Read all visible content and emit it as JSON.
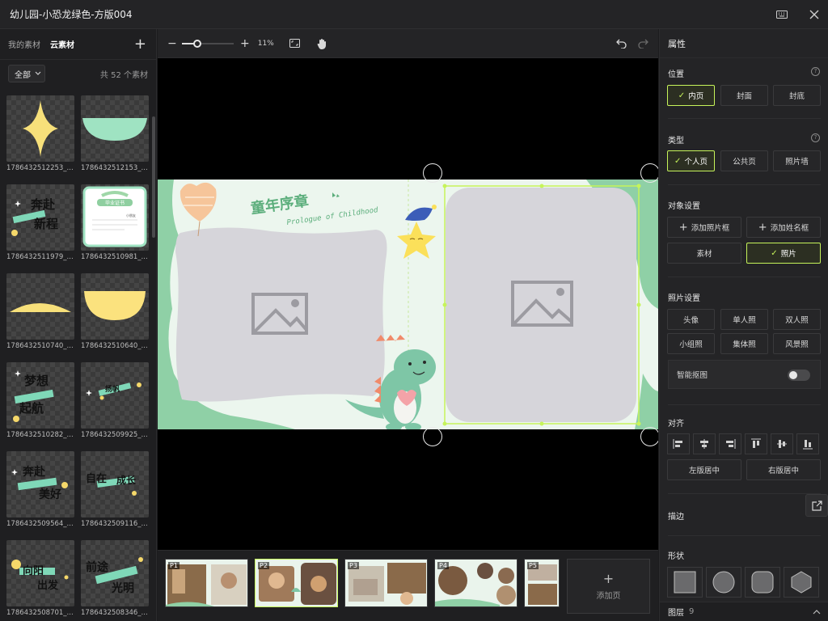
{
  "window": {
    "title": "幼儿园-小恐龙绿色-方版004"
  },
  "left_panel": {
    "tabs": [
      {
        "label": "我的素材",
        "active": false
      },
      {
        "label": "云素材",
        "active": true
      }
    ],
    "filter": {
      "selected": "全部",
      "count_text": "共 52 个素材"
    },
    "assets": [
      {
        "label": "1786432512253_...",
        "icon": "four-point-star"
      },
      {
        "label": "1786432512153_...",
        "icon": "green-half-circle"
      },
      {
        "label": "1786432511979_...",
        "icon": "calligraphy-title"
      },
      {
        "label": "1786432510981_...",
        "icon": "certificate-card"
      },
      {
        "label": "1786432510740_...",
        "icon": "yellow-wave"
      },
      {
        "label": "1786432510640_...",
        "icon": "yellow-half-circle"
      },
      {
        "label": "1786432510282_...",
        "icon": "calligraphy-title"
      },
      {
        "label": "1786432509925_...",
        "icon": "calligraphy-title"
      },
      {
        "label": "1786432509564_...",
        "icon": "calligraphy-title"
      },
      {
        "label": "1786432509116_...",
        "icon": "calligraphy-title"
      },
      {
        "label": "1786432508701_...",
        "icon": "calligraphy-title"
      },
      {
        "label": "1786432508346_...",
        "icon": "calligraphy-title"
      }
    ],
    "asset_texts": {
      "a3": [
        "奔赴",
        "新程"
      ],
      "a4_title": "毕业证书",
      "a4_name": "小朋友",
      "a7": [
        "梦想",
        "起航"
      ],
      "a8": "扬帆",
      "a9": [
        "奔赴",
        "美好"
      ],
      "a10": [
        "自在",
        "成长"
      ],
      "a11": [
        "向阳",
        "出发"
      ],
      "a12": [
        "前途",
        "光明"
      ]
    }
  },
  "toolbar": {
    "zoom": "11%",
    "zoom_level": 0.3
  },
  "canvas": {
    "spread_title": "童年序章",
    "spread_subtitle": "Prologue of Childhood"
  },
  "pages": [
    {
      "label": "P1",
      "active": false
    },
    {
      "label": "P2",
      "active": true
    },
    {
      "label": "P3",
      "active": false
    },
    {
      "label": "P4",
      "active": false
    },
    {
      "label": "P5",
      "active": false
    }
  ],
  "add_page_label": "添加页",
  "properties": {
    "header": "属性",
    "position": {
      "title": "位置",
      "options": [
        "内页",
        "封面",
        "封底"
      ],
      "selected": "内页"
    },
    "type": {
      "title": "类型",
      "options": [
        "个人页",
        "公共页",
        "照片墙"
      ],
      "selected": "个人页"
    },
    "object": {
      "title": "对象设置",
      "add_photo_frame": "添加照片框",
      "add_name_frame": "添加姓名框",
      "material": "素材",
      "photo": "照片",
      "selected": "照片"
    },
    "photo_settings": {
      "title": "照片设置",
      "options": [
        "头像",
        "单人照",
        "双人照",
        "小组照",
        "集体照",
        "风景照"
      ],
      "smart_cutout": "智能抠图",
      "smart_cutout_on": false
    },
    "align": {
      "title": "对齐",
      "left_center": "左版居中",
      "right_center": "右版居中"
    },
    "stroke": {
      "title": "描边"
    },
    "shape": {
      "title": "形状"
    },
    "layers": {
      "label": "图层",
      "count": "9"
    }
  },
  "colors": {
    "accent": "#c6f45a",
    "spread_green": "#8fd0a6",
    "placeholder_gray": "#d6d5da"
  }
}
